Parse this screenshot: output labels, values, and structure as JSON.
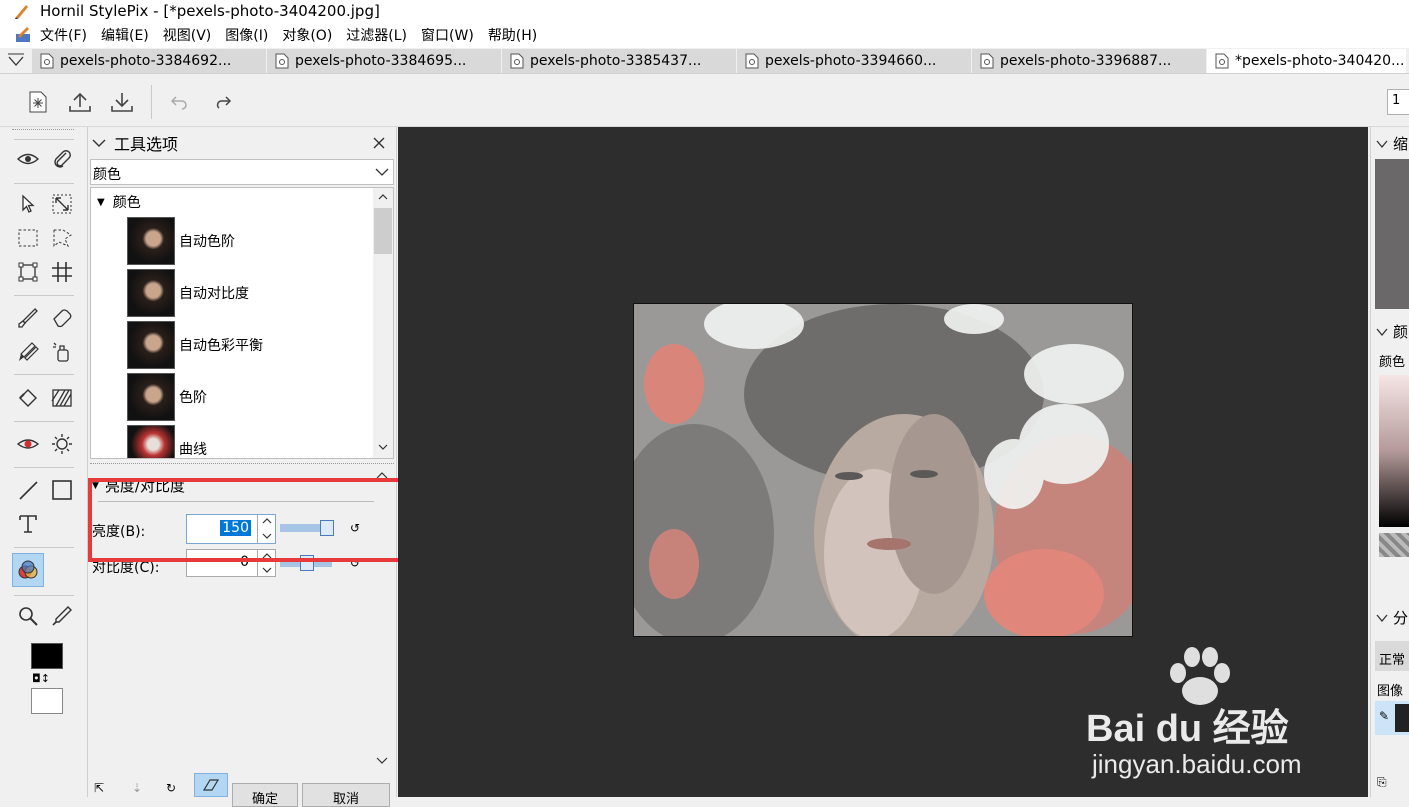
{
  "window": {
    "title": "Hornil StylePix - [*pexels-photo-3404200.jpg]"
  },
  "menu": [
    "文件(F)",
    "编辑(E)",
    "视图(V)",
    "图像(I)",
    "对象(O)",
    "过滤器(L)",
    "窗口(W)",
    "帮助(H)"
  ],
  "tabs": [
    {
      "label": "pexels-photo-3384692..."
    },
    {
      "label": "pexels-photo-3384695..."
    },
    {
      "label": "pexels-photo-3385437..."
    },
    {
      "label": "pexels-photo-3394660..."
    },
    {
      "label": "pexels-photo-3396887..."
    },
    {
      "label": "*pexels-photo-340420..."
    }
  ],
  "toolbar": {
    "zoom_value": "1"
  },
  "tool_options": {
    "title": "工具选项",
    "category_select": "颜色",
    "tree_root": "颜色",
    "items": [
      "自动色阶",
      "自动对比度",
      "自动色彩平衡",
      "色阶",
      "曲线"
    ],
    "section_title": "亮度/对比度",
    "brightness_label": "亮度(B):",
    "brightness_value": "150",
    "contrast_label": "对比度(C):",
    "contrast_value": "0",
    "ok_label": "确定",
    "cancel_label": "取消"
  },
  "right_panel": {
    "nav_title": "缩",
    "color_title": "颜",
    "color_label": "颜色",
    "layers_title": "分",
    "blend_mode": "正常",
    "image_label": "图像"
  },
  "watermark": {
    "brand": "Bai du 经验",
    "url": "jingyan.baidu.com"
  },
  "colors": {
    "highlight_box": "#e83a3a",
    "canvas_bg": "#2d2d2d",
    "accent": "#0078d7"
  }
}
